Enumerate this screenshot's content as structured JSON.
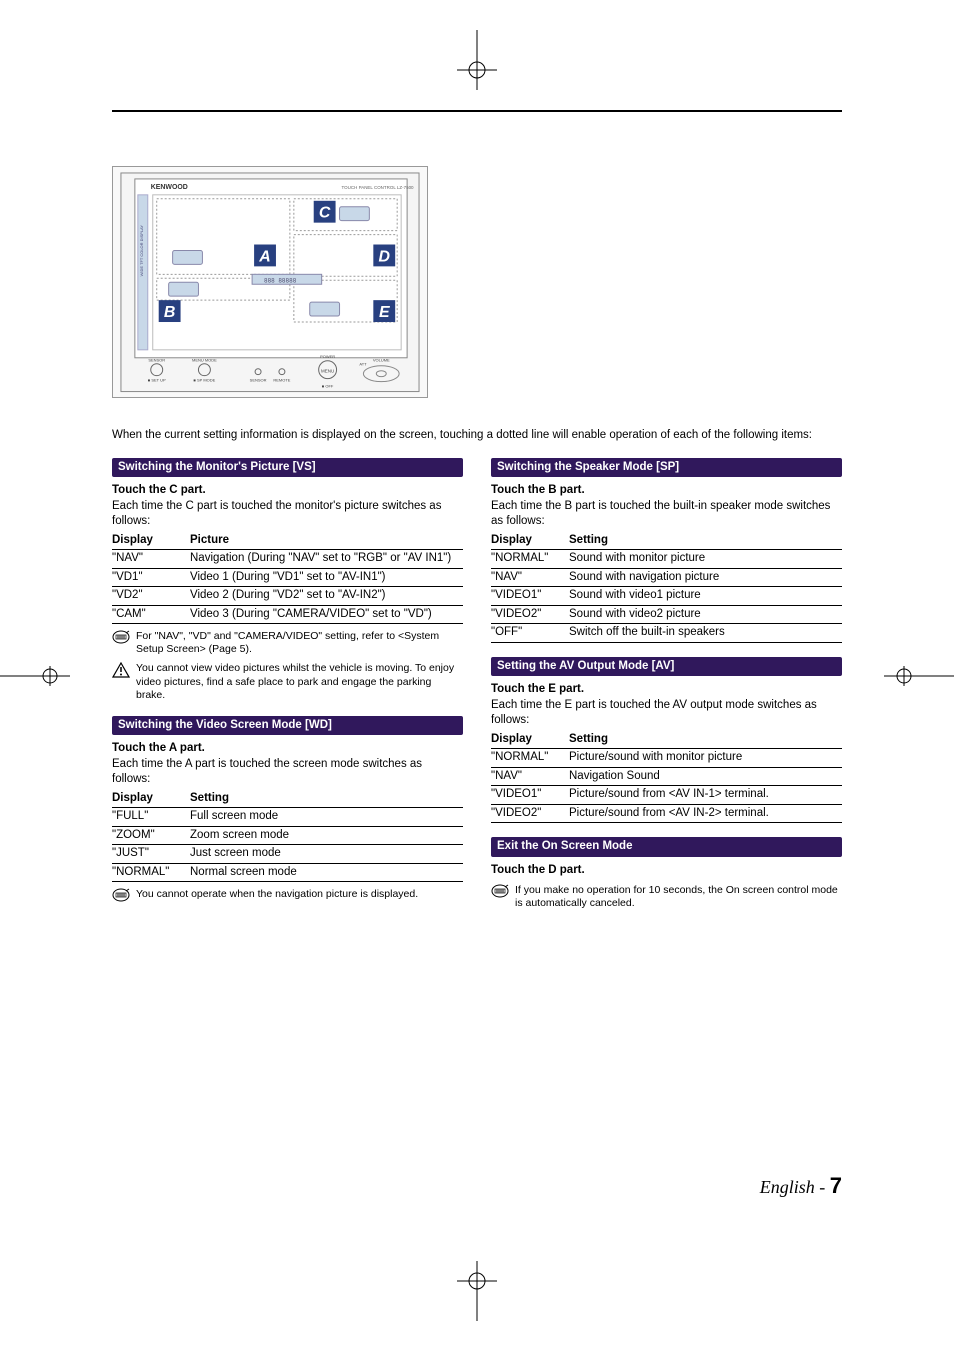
{
  "intro": "When the current setting information is displayed on the screen, touching a dotted line will enable operation of each of the following items:",
  "device": {
    "brand": "KENWOOD",
    "model": "TOUCH PANEL CONTROL LZ-7500",
    "labels": {
      "A": "A",
      "B": "B",
      "C": "C",
      "D": "D",
      "E": "E"
    },
    "bottom_labels": [
      "SENSOR",
      "MENU MODE",
      "SENSOR",
      "REMOTE",
      "OFF",
      "POWER",
      "ATT",
      "MENU",
      "VOLUME"
    ]
  },
  "sections": {
    "vs": {
      "title": "Switching the Monitor's Picture [VS]",
      "subhead": "Touch the C part.",
      "desc": "Each time the C part is touched the monitor's picture switches as follows:",
      "headers": [
        "Display",
        "Picture"
      ],
      "rows": [
        [
          "\"NAV\"",
          "Navigation (During \"NAV\" set to \"RGB\" or \"AV IN1\")"
        ],
        [
          "\"VD1\"",
          "Video 1 (During \"VD1\" set to \"AV-IN1\")"
        ],
        [
          "\"VD2\"",
          "Video 2 (During \"VD2\" set to \"AV-IN2\")"
        ],
        [
          "\"CAM\"",
          "Video 3 (During \"CAMERA/VIDEO\" set to \"VD\")"
        ]
      ],
      "note1": "For \"NAV\", \"VD\" and \"CAMERA/VIDEO\" setting, refer to <System  Setup Screen> (Page 5).",
      "note2": "You cannot view video pictures whilst the vehicle is moving. To enjoy video pictures, find a safe place to park and engage the parking brake."
    },
    "wd": {
      "title": "Switching the Video Screen Mode [WD]",
      "subhead": "Touch the A part.",
      "desc": "Each time the A part is touched the screen mode switches as follows:",
      "headers": [
        "Display",
        "Setting"
      ],
      "rows": [
        [
          "\"FULL\"",
          "Full screen mode"
        ],
        [
          "\"ZOOM\"",
          "Zoom screen mode"
        ],
        [
          "\"JUST\"",
          "Just screen mode"
        ],
        [
          "\"NORMAL\"",
          "Normal screen mode"
        ]
      ],
      "note1": "You cannot operate when the navigation picture is displayed."
    },
    "sp": {
      "title": "Switching the Speaker Mode [SP]",
      "subhead": "Touch the B part.",
      "desc": "Each time the B part is touched the built-in speaker mode switches as follows:",
      "headers": [
        "Display",
        "Setting"
      ],
      "rows": [
        [
          "\"NORMAL\"",
          "Sound with monitor picture"
        ],
        [
          "\"NAV\"",
          "Sound with navigation picture"
        ],
        [
          "\"VIDEO1\"",
          "Sound with video1 picture"
        ],
        [
          "\"VIDEO2\"",
          "Sound with video2 picture"
        ],
        [
          "\"OFF\"",
          "Switch off the built-in speakers"
        ]
      ]
    },
    "av": {
      "title": "Setting the AV Output Mode [AV]",
      "subhead": "Touch the E part.",
      "desc": "Each time the E part is touched the AV output mode switches as follows:",
      "headers": [
        "Display",
        "Setting"
      ],
      "rows": [
        [
          "\"NORMAL\"",
          "Picture/sound with monitor picture"
        ],
        [
          "\"NAV\"",
          "Navigation Sound"
        ],
        [
          "\"VIDEO1\"",
          "Picture/sound from <AV IN-1> terminal."
        ],
        [
          "\"VIDEO2\"",
          "Picture/sound from <AV IN-2> terminal."
        ]
      ]
    },
    "exit": {
      "title": "Exit the On Screen Mode",
      "subhead": "Touch the D part.",
      "note1": "If you make no operation for 10 seconds, the On screen control mode is automatically canceled."
    }
  },
  "footer": {
    "lang": "English",
    "sep": " - ",
    "page": "7"
  }
}
